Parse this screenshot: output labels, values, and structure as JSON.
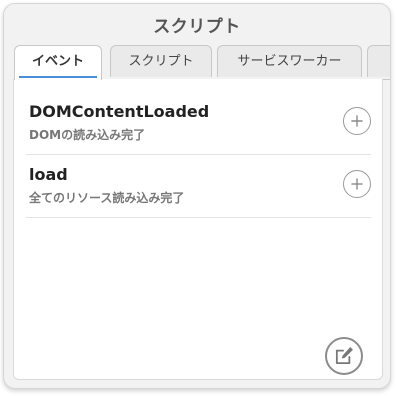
{
  "panel": {
    "title": "スクリプト"
  },
  "tabs": [
    {
      "label": "イベント",
      "active": true
    },
    {
      "label": "スクリプト",
      "active": false
    },
    {
      "label": "サービスワーカー",
      "active": false
    },
    {
      "label": "",
      "active": false
    }
  ],
  "events": [
    {
      "name": "DOMContentLoaded",
      "description": "DOMの読み込み完了",
      "action_icon": "plus-circle-icon"
    },
    {
      "name": "load",
      "description": "全てのリソース読み込み完了",
      "action_icon": "plus-circle-icon"
    }
  ],
  "footer": {
    "edit_icon": "edit-icon"
  }
}
